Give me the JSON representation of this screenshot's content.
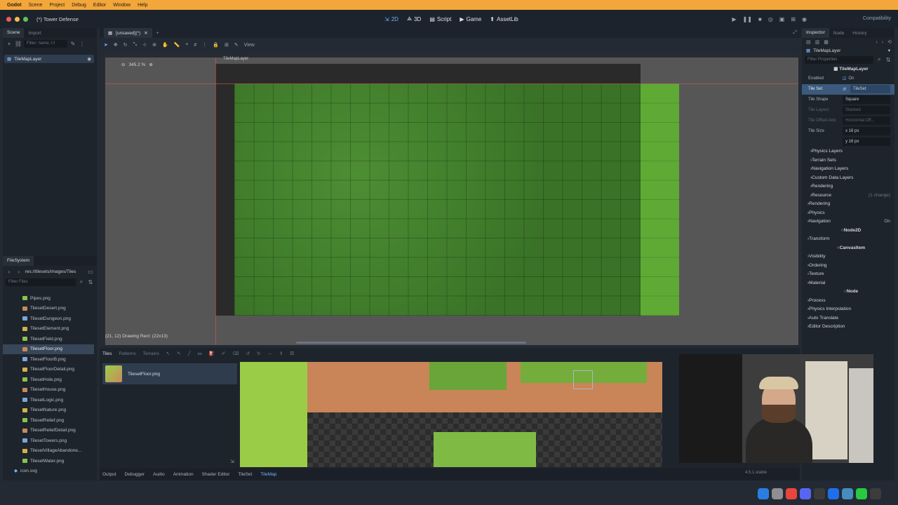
{
  "mac_menu": {
    "app": "Godot",
    "items": [
      "Scene",
      "Project",
      "Debug",
      "Editor",
      "Window",
      "Help"
    ]
  },
  "window": {
    "title": "(*) Tower Defense"
  },
  "main_screens": [
    {
      "label": "2D",
      "icon": "2d-icon",
      "active": true
    },
    {
      "label": "3D",
      "icon": "3d-icon",
      "active": false
    },
    {
      "label": "Script",
      "icon": "script-icon",
      "active": false
    },
    {
      "label": "Game",
      "icon": "game-icon",
      "active": false
    },
    {
      "label": "AssetLib",
      "icon": "assetlib-icon",
      "active": false
    }
  ],
  "renderer": "Compatibility",
  "scene_dock": {
    "tabs": [
      "Scene",
      "Import"
    ],
    "filter_placeholder": "Filter: name, t:t",
    "root_node": "TileMapLayer"
  },
  "filesystem": {
    "title": "FileSystem",
    "path": "res://tilesets/images/Tiles",
    "filter_placeholder": "Filter Files",
    "files": [
      "Pipes.png",
      "TilesetDesert.png",
      "TilesetDungeon.png",
      "TilesetElement.png",
      "TilesetField.png",
      "TilesetFloor.png",
      "TilesetFloorB.png",
      "TilesetFloorDetail.png",
      "TilesetHole.png",
      "TilesetHouse.png",
      "TilesetLogic.png",
      "TilesetNature.png",
      "TilesetRelief.png",
      "TilesetReliefDetail.png",
      "TilesetTowers.png",
      "TilesetVillageAbandone...",
      "TilesetWater.png"
    ],
    "selected": "TilesetFloor.png",
    "footer_file": "icon.svg"
  },
  "editor": {
    "tab_label": "[unsaved](*)",
    "view_menu": "View",
    "zoom": "345.2 %",
    "node_label": "TileMapLayer",
    "draw_info": "(21, 12) Drawing Rect: (22x13)"
  },
  "tiles_panel": {
    "tabs": [
      "Tiles",
      "Patterns",
      "Terrains"
    ],
    "active_tab": "Tiles",
    "source_item": "TilesetFloor.png"
  },
  "bottom_bar": {
    "tabs": [
      "Output",
      "Debugger",
      "Audio",
      "Animation",
      "Shader Editor",
      "TileSet",
      "TileMap"
    ],
    "active": "TileMap",
    "version": "4.5.1.stable"
  },
  "inspector": {
    "tabs": [
      "Inspector",
      "Node",
      "History"
    ],
    "object": "TileMapLayer",
    "filter_placeholder": "Filter Properties",
    "class_header": "TileMapLayer",
    "enabled_label": "Enabled",
    "enabled_value": "On",
    "tile_set_label": "Tile Set",
    "tile_set_value": "TileSet",
    "props": [
      {
        "k": "Tile Shape",
        "v": "Square",
        "dim": false
      },
      {
        "k": "Tile Layout",
        "v": "Stacked",
        "dim": true
      },
      {
        "k": "Tile Offset Axis",
        "v": "Horizontal Off...",
        "dim": true
      }
    ],
    "tile_size_label": "Tile Size",
    "tile_size_x": "x  16  px",
    "tile_size_y": "y  16  px",
    "tileset_groups": [
      "Physics Layers",
      "Terrain Sets",
      "Navigation Layers",
      "Custom Data Layers",
      "Rendering"
    ],
    "resource_label": "Resource",
    "resource_changes": "(1 change)",
    "layer_groups": [
      "Rendering",
      "Physics"
    ],
    "navigation_label": "Navigation",
    "navigation_value": "On",
    "node2d_header": "Node2D",
    "node2d_groups": [
      "Transform"
    ],
    "canvasitem_header": "CanvasItem",
    "canvasitem_groups": [
      "Visibility",
      "Ordering",
      "Texture",
      "Material"
    ],
    "node_header": "Node",
    "node_groups": [
      "Process",
      "Physics Interpolation",
      "Auto Translate",
      "Editor Description"
    ]
  },
  "colors": {
    "accent": "#6fb3ff",
    "menubar": "#f3a63a",
    "grass": "#3e7a2a",
    "bright_grass": "#5faa35"
  }
}
